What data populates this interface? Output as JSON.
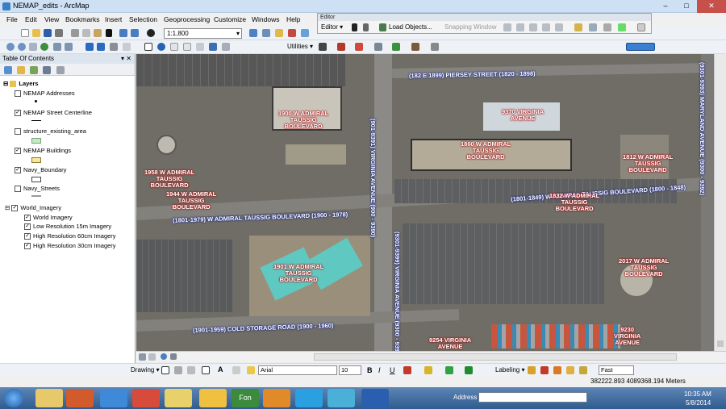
{
  "window": {
    "title": "NEMAP_edits - ArcMap",
    "min": "–",
    "max": "□",
    "close": "✕"
  },
  "menu": [
    "File",
    "Edit",
    "View",
    "Bookmarks",
    "Insert",
    "Selection",
    "Geoprocessing",
    "Customize",
    "Windows",
    "Help"
  ],
  "standard_toolbar": {
    "scale": "1:1,800"
  },
  "tools_toolbar": {
    "utilities": "Utilities ▾"
  },
  "editor": {
    "title": "Editor",
    "menu": "Editor ▾",
    "load_objects": "Load Objects...",
    "snapping": "Snapping Window"
  },
  "toc": {
    "title": "Table Of Contents",
    "pin": "▾ ✕",
    "root": "Layers",
    "layers": [
      {
        "name": "NEMAP Addresses",
        "checked": false,
        "color": "#000000",
        "symbol": "point"
      },
      {
        "name": "NEMAP Street Centerline",
        "checked": true,
        "color": "#000000",
        "symbol": "line"
      },
      {
        "name": "structure_existing_area",
        "checked": false,
        "color": "#c7e8c6",
        "symbol": "fill"
      },
      {
        "name": "NEMAP Buildings",
        "checked": true,
        "color": "#f5e7a3",
        "symbol": "fill"
      },
      {
        "name": "Navy_Boundary",
        "checked": true,
        "color": "#ffffff",
        "symbol": "fill"
      },
      {
        "name": "Navy_Streets",
        "checked": false,
        "color": "#9a9a9a",
        "symbol": "line"
      },
      {
        "name": "World_Imagery",
        "checked": true,
        "color": "",
        "symbol": "group"
      }
    ],
    "sublayers": [
      "World Imagery",
      "Low Resolution 15m Imagery",
      "High Resolution 60cm Imagery",
      "High Resolution 30cm Imagery"
    ]
  },
  "map": {
    "streets": [
      "(182 E 1899) PIERSEY STREET (1820 - 1898)",
      "(1801-1979) W ADMIRAL TAUSSIG BOULEVARD (1900 - 1978)",
      "(1801-1849) W ADMIRAL TAUSSIG BOULEVARD (1800 - 1848)",
      "(1901-1959) COLD STORAGE ROAD (1900 - 1960)",
      "(901-9391) VIRGINIA AVENUE (900 - 9390)",
      "(9301-9399) VIRGINIA AVENUE (9300 - 9398)",
      "(9301-9393) MARYLAND AVENUE (9300 - 9392)"
    ],
    "addresses": [
      "1900 W ADMIRAL\nTAUSSIG\nBOULEVARD",
      "9370 VIRGINIA\nAVENUE",
      "1860 W ADMIRAL\nTAUSSIG\nBOULEVARD",
      "1812 W ADMIRAL\nTAUSSIG\nBOULEVARD",
      "1958 W ADMIRAL\nTAUSSIG\nBOULEVARD",
      "1944 W ADMIRAL\nTAUSSIG\nBOULEVARD",
      "1832 W ADMIRAL\nTAUSSIG\nBOULEVARD",
      "1901 W ADMIRAL\nTAUSSIG\nBOULEVARD",
      "2017 W ADMIRAL\nTAUSSIG\nBOULEVARD",
      "9254 VIRGINIA\nAVENUE",
      "9230\nVIRGINIA\nAVENUE"
    ]
  },
  "drawing": {
    "label": "Drawing ▾",
    "font": "Arial",
    "size": "10",
    "bold": "B",
    "italic": "I",
    "underline": "U",
    "labeling": "Labeling ▾",
    "quality": "Fast"
  },
  "status": {
    "coords": "382222.893  4089368.194 Meters"
  },
  "taskbar": {
    "address_label": "Address",
    "time": "10:35 AM",
    "date": "5/8/2014",
    "apps": [
      "Fon"
    ]
  },
  "colors": {
    "street_label_halo": "#1d2a8a",
    "address_label_halo": "#a41212"
  }
}
